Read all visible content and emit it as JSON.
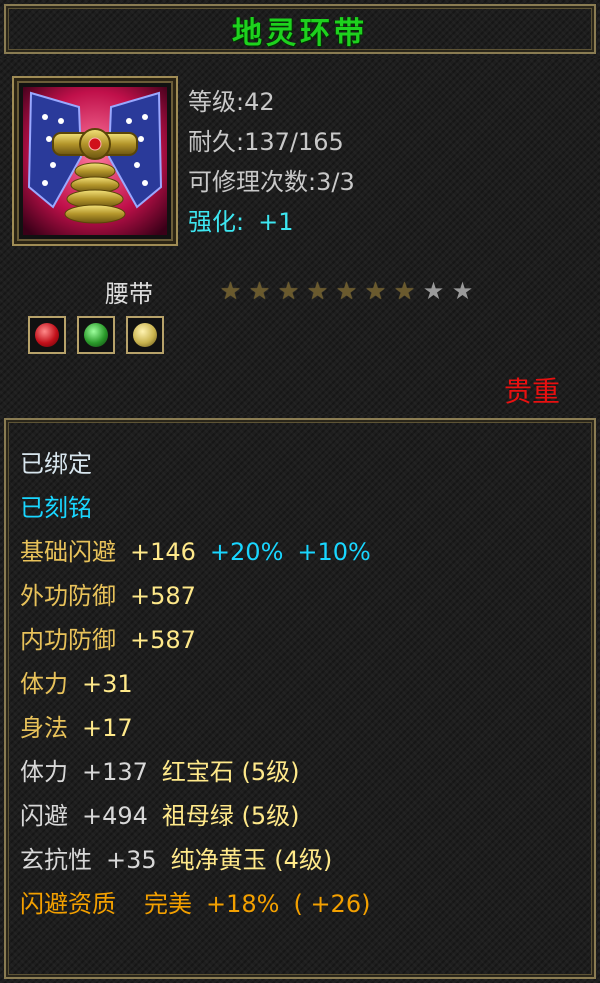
{
  "item": {
    "name": "地灵环带",
    "level": "等级:42",
    "durability": "耐久:137/165",
    "repair_count": "可修理次数:3/3",
    "enhance_label": "强化:",
    "enhance_value": "+1",
    "type": "腰带",
    "stars_total": 9,
    "stars_filled": 7,
    "rarity": "贵重",
    "gems": [
      "ruby-gem-icon",
      "emerald-gem-icon",
      "yellow-jade-gem-icon"
    ]
  },
  "colors": {
    "title": "#1ed21e",
    "enhance": "#3de6f0",
    "rarity": "#e81010",
    "attr_gold": "#e8c25a",
    "attr_cyan": "#19d6ff",
    "attr_orange": "#f3a000"
  },
  "status": {
    "bound": "已绑定",
    "engraved": "已刻铭"
  },
  "attributes": {
    "base_dodge": {
      "name": "基础闪避",
      "value": "+146",
      "bonus1": "+20%",
      "bonus2": "+10%"
    },
    "ext_def": {
      "name": "外功防御",
      "value": "+587"
    },
    "int_def": {
      "name": "内功防御",
      "value": "+587"
    },
    "stamina": {
      "name": "体力",
      "value": "+31"
    },
    "agility": {
      "name": "身法",
      "value": "+17"
    },
    "gem_stamina": {
      "name": "体力",
      "value": "+137",
      "gem": "红宝石 (5级)"
    },
    "gem_dodge": {
      "name": "闪避",
      "value": "+494",
      "gem": "祖母绿 (5级)"
    },
    "gem_resist": {
      "name": "玄抗性",
      "value": "+35",
      "gem": "纯净黄玉 (4级)"
    },
    "aptitude": {
      "name": "闪避资质",
      "grade": "完美",
      "value": "+18%",
      "extra": "( +26)"
    }
  }
}
